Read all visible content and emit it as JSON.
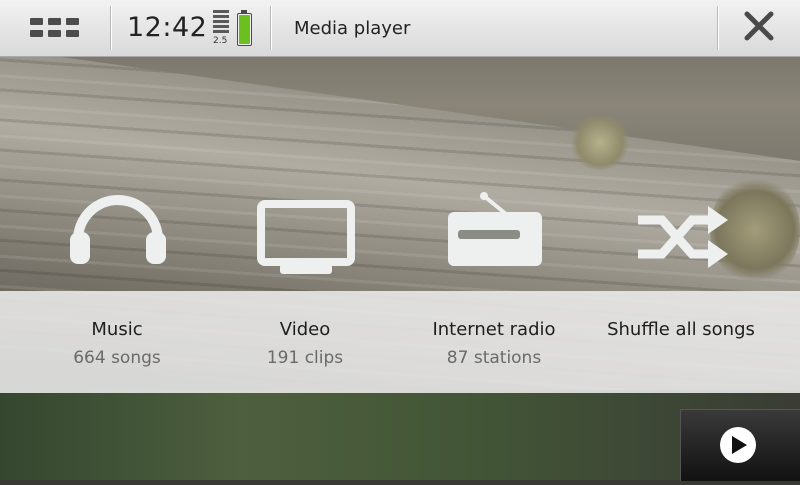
{
  "status_bar": {
    "menu_icon": "grid-menu-icon",
    "clock": "12:42",
    "signal_label": "2.5",
    "battery_icon": "battery-icon",
    "battery_level": 1.0,
    "battery_color": "#6bbf1e",
    "app_title": "Media player",
    "close_icon": "close-icon"
  },
  "categories": [
    {
      "label": "Music",
      "count": "664 songs",
      "icon": "headphones-icon"
    },
    {
      "label": "Video",
      "count": "191 clips",
      "icon": "monitor-icon"
    },
    {
      "label": "Internet radio",
      "count": "87 stations",
      "icon": "radio-icon"
    },
    {
      "label": "Shuffle all songs",
      "count": "",
      "icon": "shuffle-icon"
    }
  ],
  "now_playing": {
    "icon": "play-icon"
  }
}
